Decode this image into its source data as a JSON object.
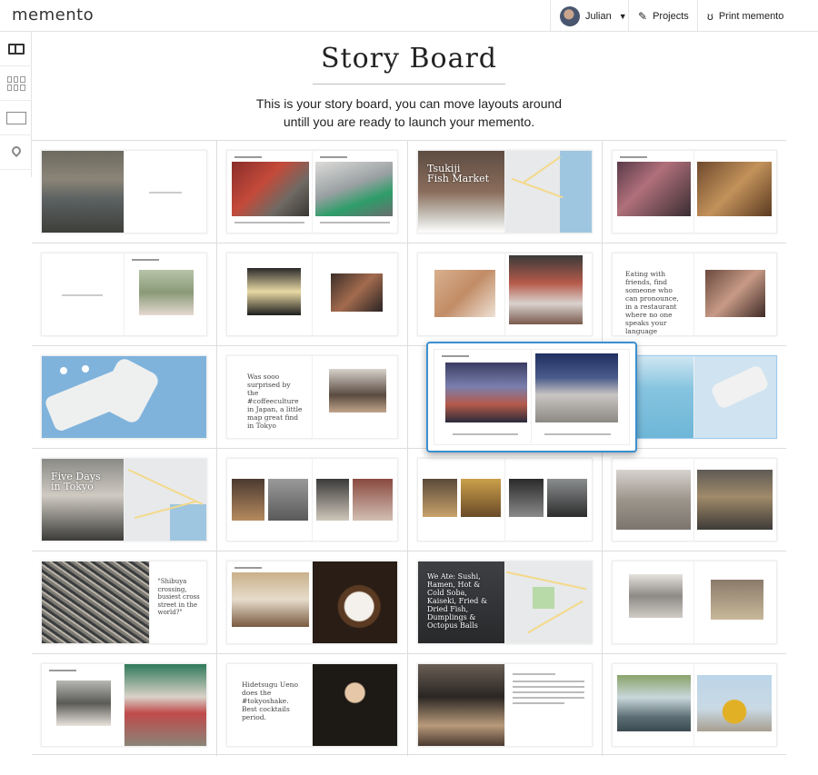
{
  "app": {
    "logo": "memento",
    "user_name": "Julian",
    "projects_label": "Projects",
    "print_label": "Print memento"
  },
  "rail": {
    "items": [
      "book-icon",
      "grid-icon",
      "single-page-icon",
      "map-pin-icon"
    ]
  },
  "header": {
    "title": "Story Board",
    "subtitle_line1": "This is your story board, you can move layouts around",
    "subtitle_line2": "untill you are ready to launch your memento."
  },
  "spreads": {
    "r1c3_overlay": "Tsukiji\nFish Market",
    "r2c4_quote": "Eating with friends, find someone who can pronounce, in a restaurant where no one speaks your language #priceless",
    "r3c2_quote": "Was sooo surprised by the #coffeeculture in Japan, a little map great find in Tokyo",
    "r3c4_overlay": "...",
    "r4c1_overlay": "Five Days\nin Tokyo",
    "r5c1_quote": "\"Shibuya crossing, busiest cross street in the world?\"",
    "r5c3_overlay": "We Ate: Sushi, Ramen, Hot & Cold Soba, Kaiseki, Fried & Dried Fish, Dumplings & Octopus Balls",
    "r6c2_quote": "Hidetsugu Ueno does the #tokyoshake. Best cocktails period."
  },
  "colors": {
    "selection": "#3a8fd0",
    "map_water": "#9fc6e0",
    "map_road": "#f4d98a"
  }
}
